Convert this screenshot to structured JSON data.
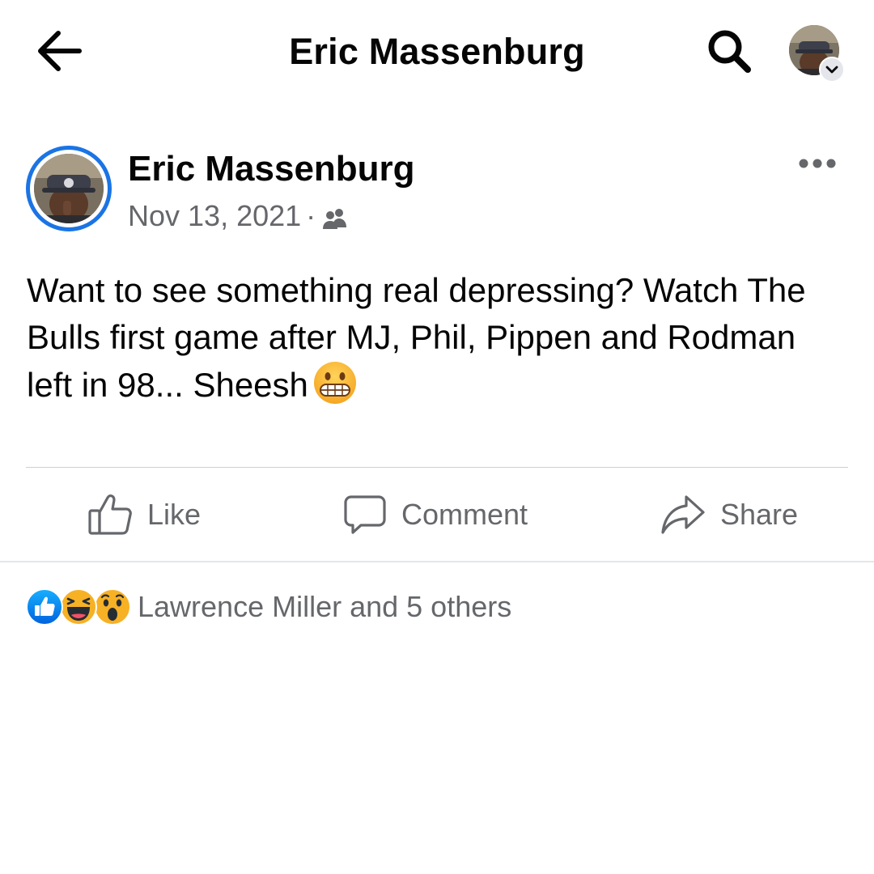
{
  "header": {
    "title": "Eric Massenburg",
    "back_icon": "arrow-left-icon",
    "search_icon": "search-icon",
    "profile_icon": "profile-avatar",
    "profile_menu_icon": "chevron-down-icon"
  },
  "post": {
    "author": "Eric Massenburg",
    "date": "Nov 13, 2021",
    "separator": "·",
    "audience_icon": "friends-icon",
    "more_icon": "more-horizontal-icon",
    "text": "Want to see something real depressing? Watch The Bulls first game after MJ, Phil, Pippen and Rodman left in 98... Sheesh",
    "text_emoji": "grimacing-face-emoji"
  },
  "actions": {
    "like": "Like",
    "comment": "Comment",
    "share": "Share"
  },
  "reactions": {
    "types": [
      "like",
      "haha",
      "wow"
    ],
    "summary": "Lawrence Miller and 5 others"
  },
  "colors": {
    "accent": "#1b74e4",
    "secondary_text": "#65676b",
    "divider": "#ced0d4",
    "reaction_yellow": "#f7b125"
  }
}
